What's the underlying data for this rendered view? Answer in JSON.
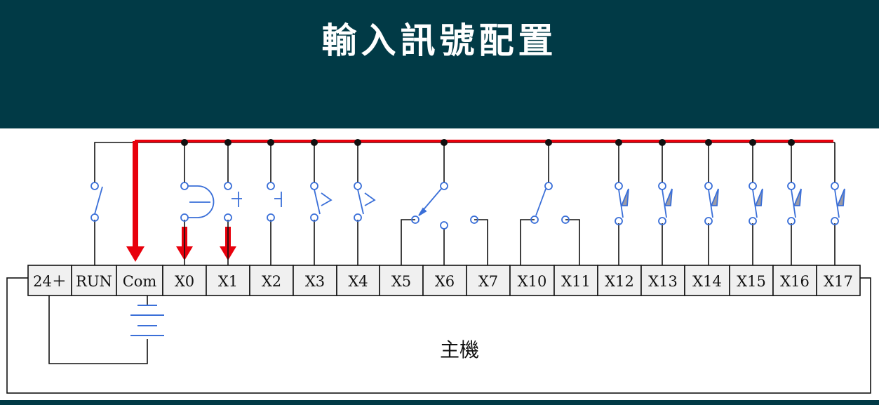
{
  "title": "輸入訊號配置",
  "host_label": "主機",
  "terminals": [
    "24＋",
    "RUN",
    "Com",
    "X0",
    "X1",
    "X2",
    "X3",
    "X4",
    "X5",
    "X6",
    "X7",
    "X10",
    "X11",
    "X12",
    "X13",
    "X14",
    "X15",
    "X16",
    "X17"
  ],
  "colors": {
    "header_bg": "#013a46",
    "title": "#ffffff",
    "wire": "#111111",
    "contact": "#3a6fd8",
    "highlight": "#e8000c",
    "terminal_fill": "#f0f0f0"
  },
  "icons": {
    "run_switch": "toggle-switch-icon",
    "x0": "limit-switch-icon",
    "x1": "push-button-icon",
    "x2": "push-button-icon",
    "x3": "foot-switch-icon",
    "x4": "foot-switch-icon",
    "x5_x7": "rotary-selector-icon",
    "x10_x11": "toggle-switch-icon",
    "x12_x17": "proximity-sensor-icon",
    "battery": "battery-icon",
    "arrows": "current-flow-arrow-icon"
  }
}
